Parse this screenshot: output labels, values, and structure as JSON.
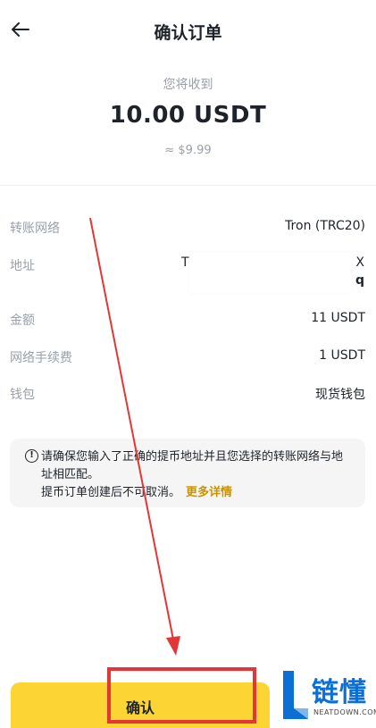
{
  "header": {
    "title": "确认订单",
    "back_icon": "arrow-left-icon"
  },
  "receive": {
    "label": "您将收到",
    "amount": "10.00 USDT",
    "approx": "≈ $9.99"
  },
  "details": {
    "network": {
      "label": "转账网络",
      "value": "Tron (TRC20)"
    },
    "address": {
      "label": "地址",
      "start": "T",
      "end_line1": "X",
      "end_line2": "q"
    },
    "amount": {
      "label": "金额",
      "value": "11 USDT"
    },
    "fee": {
      "label": "网络手续费",
      "value": "1 USDT"
    },
    "wallet": {
      "label": "钱包",
      "value": "现货钱包"
    }
  },
  "notice": {
    "icon": "warning-circle-icon",
    "line1": "请确保您输入了正确的提币地址并且您选择的转账网络与地址相匹配。",
    "line2": "提币订单创建后不可取消。",
    "link": "更多详情"
  },
  "footer": {
    "confirm_label": "确认"
  },
  "watermark": {
    "text": "链懂",
    "sub": "NEATDOWN.COM"
  },
  "colors": {
    "accent_yellow": "#fcd535",
    "link_gold": "#c99400",
    "annotation_red": "#e43636",
    "brand_blue": "#0b6fd6"
  }
}
